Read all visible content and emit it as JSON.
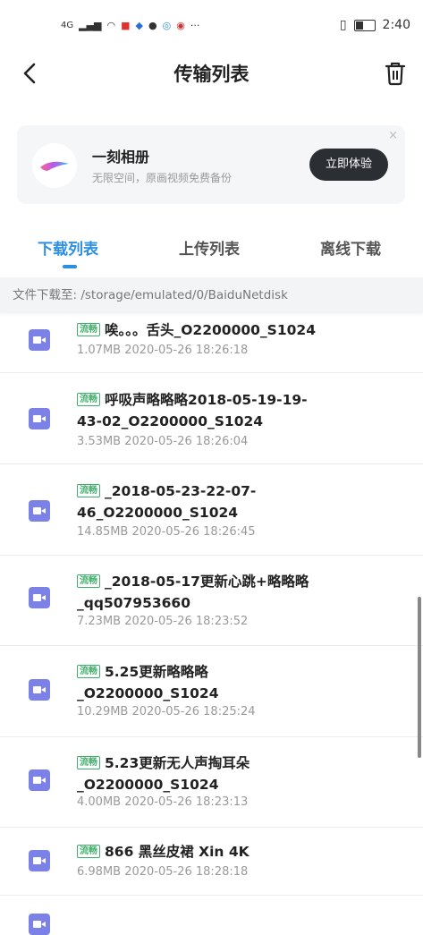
{
  "status_bar": {
    "network": "4G",
    "time": "2:40"
  },
  "header": {
    "title": "传输列表"
  },
  "banner": {
    "name": "一刻相册",
    "desc": "无限空间，原画视频免费备份",
    "button": "立即体验",
    "close": "×"
  },
  "tabs": [
    {
      "label": "下载列表",
      "active": true
    },
    {
      "label": "上传列表",
      "active": false
    },
    {
      "label": "离线下载",
      "active": false
    }
  ],
  "path": {
    "text": "文件下载至: /storage/emulated/0/BaiduNetdisk"
  },
  "badge_label": "流畅",
  "files": [
    {
      "line1": "唉。。。舌头_O2200000_S1024",
      "line2": "",
      "meta": "1.07MB 2020-05-26 18:26:18"
    },
    {
      "line1": "呼吸声略略略2018-05-19-19-",
      "line2": "43-02_O2200000_S1024",
      "meta": "3.53MB 2020-05-26 18:26:04"
    },
    {
      "line1": "_2018-05-23-22-07-",
      "line2": "46_O2200000_S1024",
      "meta": "14.85MB 2020-05-26 18:26:45"
    },
    {
      "line1": "_2018-05-17更新心跳+略略略",
      "line2": "_qq507953660",
      "meta": "7.23MB 2020-05-26 18:23:52"
    },
    {
      "line1": "5.25更新略略略",
      "line2": "_O2200000_S1024",
      "meta": "10.29MB 2020-05-26 18:25:24"
    },
    {
      "line1": "5.23更新无人声掏耳朵",
      "line2": "_O2200000_S1024",
      "meta": "4.00MB 2020-05-26 18:23:13"
    },
    {
      "line1": "866 黑丝皮裙  Xin 4K",
      "line2": "",
      "meta": "6.98MB 2020-05-26 18:28:18"
    }
  ]
}
